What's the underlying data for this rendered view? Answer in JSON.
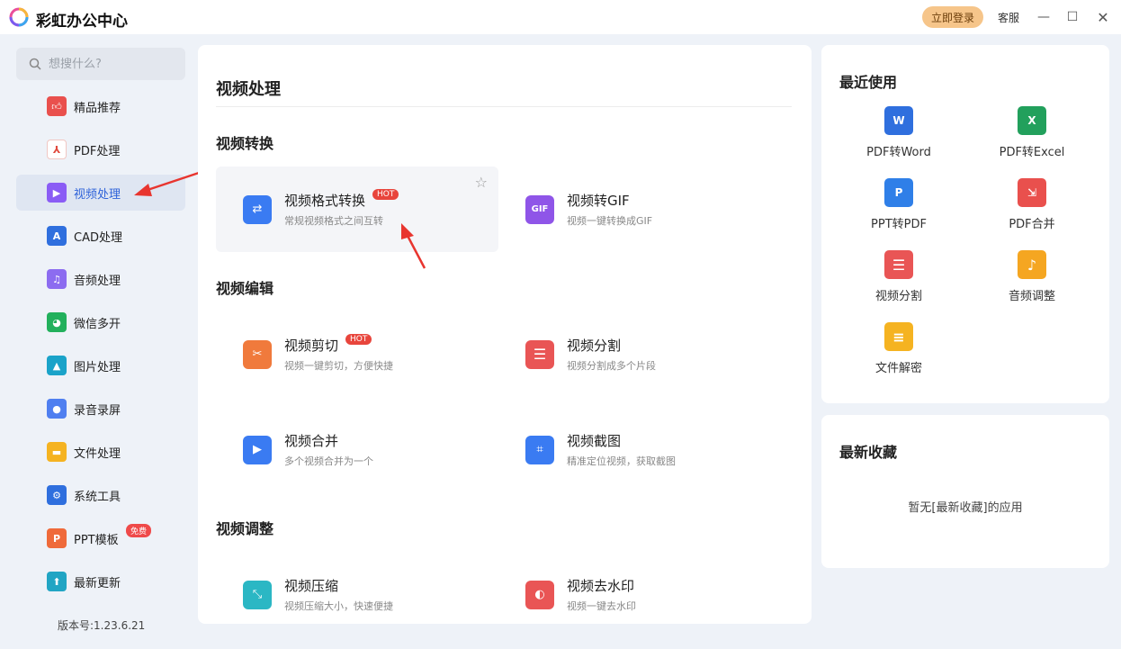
{
  "app": {
    "title": "彩虹办公中心",
    "login_label": "立即登录",
    "service_label": "客服"
  },
  "sidebar": {
    "search_placeholder": "想搜什么?",
    "items": [
      {
        "label": "精品推荐",
        "icon": "thumbs-up-icon",
        "color": "#e9504d"
      },
      {
        "label": "PDF处理",
        "icon": "pdf-icon",
        "color": "#e0483c"
      },
      {
        "label": "视频处理",
        "icon": "play-icon",
        "color": "#8a5cf5"
      },
      {
        "label": "CAD处理",
        "icon": "cad-icon",
        "color": "#2f6fde"
      },
      {
        "label": "音频处理",
        "icon": "music-icon",
        "color": "#8c6cf0"
      },
      {
        "label": "微信多开",
        "icon": "wechat-icon",
        "color": "#22b05c"
      },
      {
        "label": "图片处理",
        "icon": "image-icon",
        "color": "#1aa3c9"
      },
      {
        "label": "录音录屏",
        "icon": "microphone-icon",
        "color": "#4f7ff0"
      },
      {
        "label": "文件处理",
        "icon": "folder-icon",
        "color": "#f5b321"
      },
      {
        "label": "系统工具",
        "icon": "gear-icon",
        "color": "#2f6fde"
      },
      {
        "label": "PPT模板",
        "icon": "ppt-icon",
        "color": "#ef6a3a",
        "badge": "免费"
      },
      {
        "label": "最新更新",
        "icon": "upload-icon",
        "color": "#21a5c4"
      }
    ],
    "version": "版本号:1.23.6.21"
  },
  "main": {
    "title": "视频处理",
    "sections": [
      {
        "title": "视频转换"
      },
      {
        "title": "视频编辑"
      },
      {
        "title": "视频调整"
      }
    ],
    "cards": [
      {
        "name": "视频格式转换",
        "desc": "常规视频格式之间互转",
        "hot": "HOT",
        "icon": "swap-arrows-icon",
        "color": "#3a7bf2"
      },
      {
        "name": "视频转GIF",
        "desc": "视频一键转换成GIF",
        "icon": "gif-icon",
        "color": "#8f55e8"
      },
      {
        "name": "视频剪切",
        "desc": "视频一键剪切，方便快捷",
        "hot": "HOT",
        "icon": "scissors-icon",
        "color": "#f07a3c"
      },
      {
        "name": "视频分割",
        "desc": "视频分割成多个片段",
        "icon": "split-icon",
        "color": "#e95555"
      },
      {
        "name": "视频合并",
        "desc": "多个视频合并为一个",
        "icon": "merge-video-icon",
        "color": "#3a7bf2"
      },
      {
        "name": "视频截图",
        "desc": "精准定位视频，获取截图",
        "icon": "crop-icon",
        "color": "#3a7bf2"
      },
      {
        "name": "视频压缩",
        "desc": "视频压缩大小，快速便捷",
        "icon": "compress-icon",
        "color": "#2bb7c4"
      },
      {
        "name": "视频去水印",
        "desc": "视频一键去水印",
        "icon": "watermark-icon",
        "color": "#e95555"
      }
    ]
  },
  "recent": {
    "title": "最近使用",
    "items": [
      {
        "label": "PDF转Word",
        "icon": "pdf-to-word-icon",
        "color": "#2f6fde",
        "glyph": "W"
      },
      {
        "label": "PDF转Excel",
        "icon": "pdf-to-excel-icon",
        "color": "#22a05c",
        "glyph": "X"
      },
      {
        "label": "PPT转PDF",
        "icon": "ppt-to-pdf-icon",
        "color": "#2f7fe8",
        "glyph": "P"
      },
      {
        "label": "PDF合并",
        "icon": "pdf-merge-icon",
        "color": "#e9504d",
        "glyph": "⇲"
      },
      {
        "label": "视频分割",
        "icon": "video-split-icon",
        "color": "#e95555",
        "glyph": "☰"
      },
      {
        "label": "音频调整",
        "icon": "audio-adjust-icon",
        "color": "#f5a621",
        "glyph": "♪"
      },
      {
        "label": "文件解密",
        "icon": "file-decrypt-icon",
        "color": "#f5b321",
        "glyph": "≡"
      }
    ]
  },
  "favorites": {
    "title": "最新收藏",
    "empty": "暂无[最新收藏]的应用"
  }
}
